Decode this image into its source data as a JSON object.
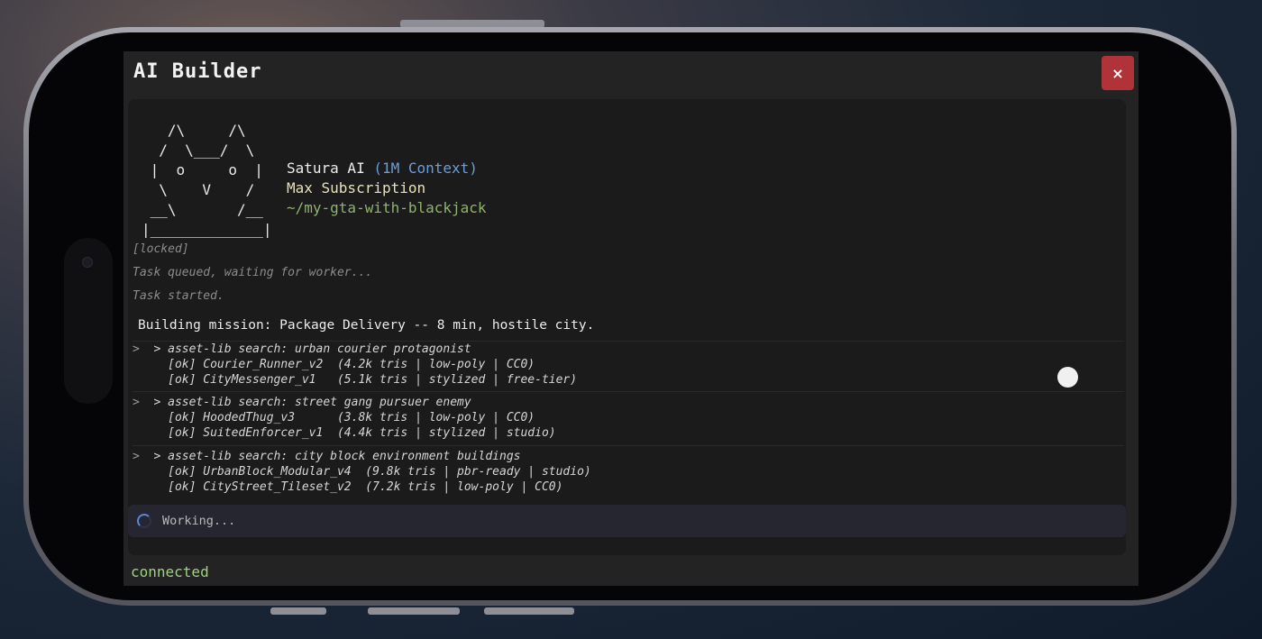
{
  "app": {
    "title": "AI Builder",
    "close_label": "×"
  },
  "banner": {
    "ascii": "   /\\     /\\\n  /  \\___/  \\\n |  o     o  |\n  \\    V    /\n __\\       /__\n|_____________|",
    "name": "Satura AI",
    "context": "(1M Context)",
    "subscription": "Max Subscription",
    "path": "~/my-gta-with-blackjack"
  },
  "log": {
    "locked": "[locked]",
    "queued": "Task queued, waiting for worker...",
    "started": "Task started.",
    "mission": "Building mission: Package Delivery -- 8 min, hostile city.",
    "groups": [
      {
        "prompt": ">",
        "command": "> asset-lib search: urban courier protagonist",
        "results": [
          "[ok] Courier_Runner_v2  (4.2k tris | low-poly | CC0)",
          "[ok] CityMessenger_v1   (5.1k tris | stylized | free-tier)"
        ]
      },
      {
        "prompt": ">",
        "command": "> asset-lib search: street gang pursuer enemy",
        "results": [
          "[ok] HoodedThug_v3      (3.8k tris | low-poly | CC0)",
          "[ok] SuitedEnforcer_v1  (4.4k tris | stylized | studio)"
        ]
      },
      {
        "prompt": ">",
        "command": "> asset-lib search: city block environment buildings",
        "results": [
          "[ok] UrbanBlock_Modular_v4  (9.8k tris | pbr-ready | studio)",
          "[ok] CityStreet_Tileset_v2  (7.2k tris | low-poly | CC0)"
        ]
      }
    ]
  },
  "working": {
    "text": "Working..."
  },
  "status": {
    "text": "connected"
  },
  "colors": {
    "accent_blue": "#6b9ddd",
    "path_green": "#8fb26f",
    "status_green": "#9fd27f",
    "close_red": "#b0333a"
  }
}
